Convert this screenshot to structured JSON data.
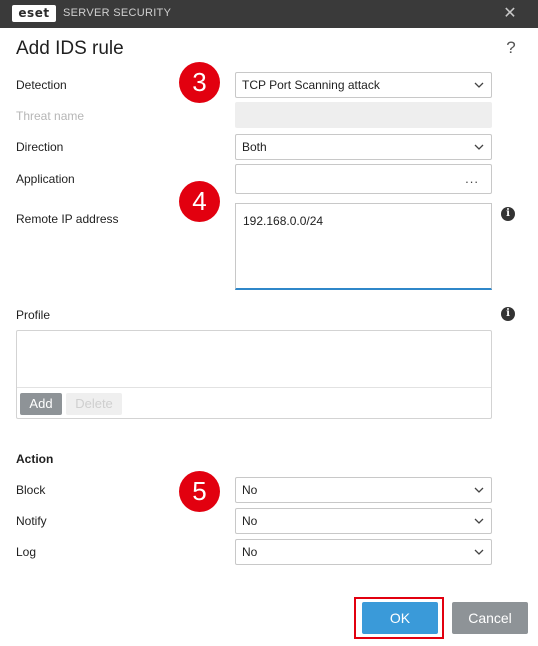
{
  "window": {
    "brand": "eset",
    "product": "SERVER SECURITY",
    "close_icon": "close-icon"
  },
  "dialog": {
    "title": "Add IDS rule",
    "help": "?"
  },
  "form": {
    "detection": {
      "label": "Detection",
      "value": "TCP Port Scanning attack"
    },
    "threat_name": {
      "label": "Threat name",
      "value": ""
    },
    "direction": {
      "label": "Direction",
      "value": "Both"
    },
    "application": {
      "label": "Application",
      "value": "",
      "browse": "..."
    },
    "remote_ip": {
      "label": "Remote IP address",
      "value": "192.168.0.0/24"
    },
    "profile": {
      "label": "Profile",
      "add": "Add",
      "delete": "Delete"
    },
    "action_header": "Action",
    "block": {
      "label": "Block",
      "value": "No"
    },
    "notify": {
      "label": "Notify",
      "value": "No"
    },
    "log": {
      "label": "Log",
      "value": "No"
    }
  },
  "annotations": {
    "step3": "3",
    "step4": "4",
    "step5": "5"
  },
  "buttons": {
    "ok": "OK",
    "cancel": "Cancel"
  },
  "colors": {
    "titlebar": "#3a3a3a",
    "accent": "#3a9ad9",
    "highlight": "#e2000f",
    "secondary_button": "#8e9397"
  }
}
